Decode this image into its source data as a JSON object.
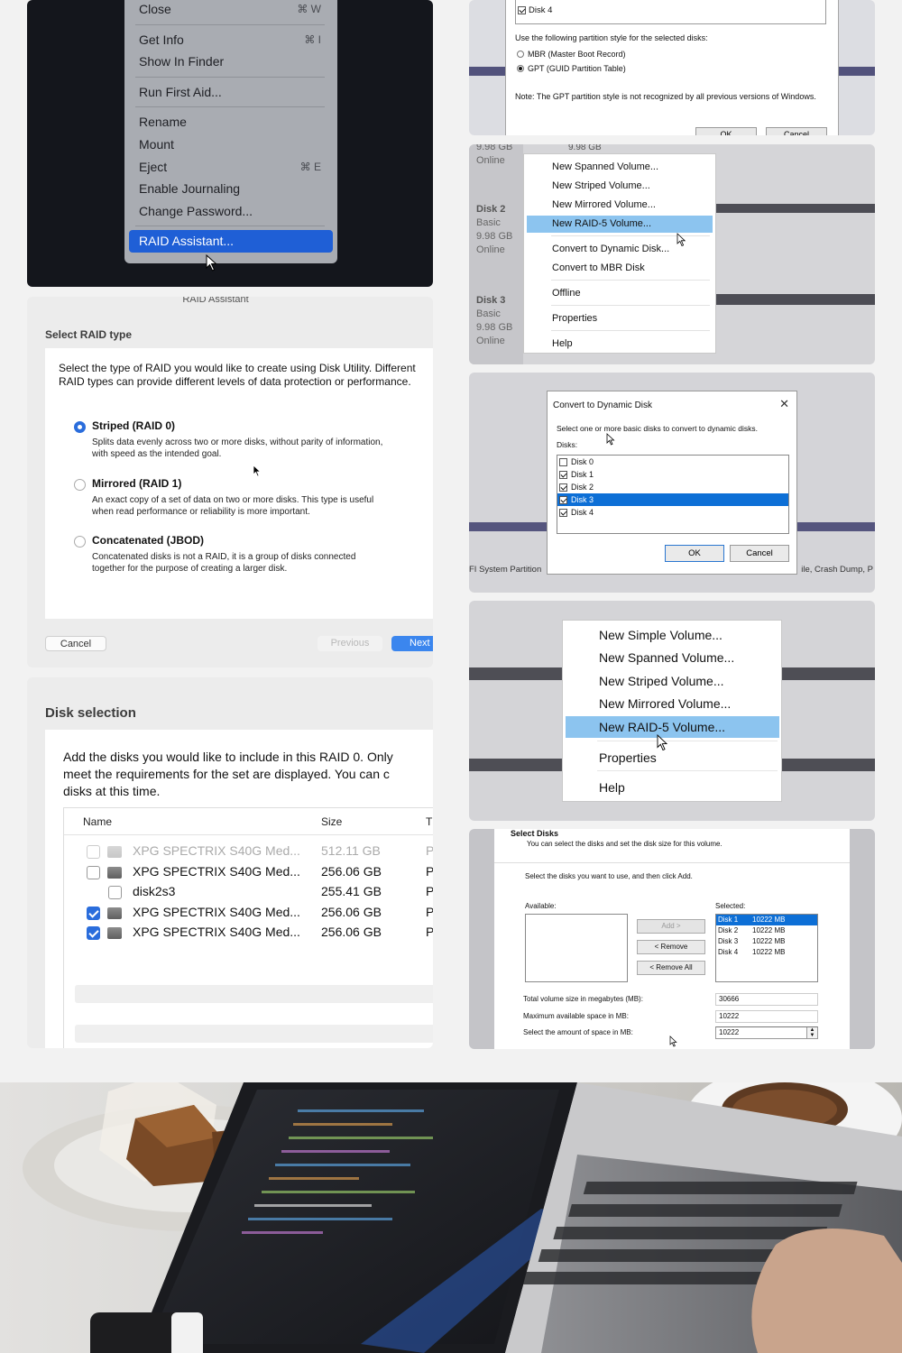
{
  "mac_context_menu": {
    "items": [
      {
        "label": "Close",
        "shortcut": "⌘ W"
      },
      {
        "sep": true
      },
      {
        "label": "Get Info",
        "shortcut": "⌘ I"
      },
      {
        "label": "Show In Finder",
        "shortcut": ""
      },
      {
        "sep": true
      },
      {
        "label": "Run First Aid...",
        "shortcut": ""
      },
      {
        "sep": true
      },
      {
        "label": "Rename",
        "shortcut": ""
      },
      {
        "label": "Mount",
        "shortcut": ""
      },
      {
        "label": "Eject",
        "shortcut": "⌘ E"
      },
      {
        "label": "Enable Journaling",
        "shortcut": ""
      },
      {
        "label": "Change Password...",
        "shortcut": ""
      },
      {
        "sep": true
      },
      {
        "label": "RAID Assistant...",
        "shortcut": "",
        "selected": true
      }
    ]
  },
  "partition_dialog": {
    "list_item": "Disk 4",
    "prompt": "Use the following partition style for the selected disks:",
    "option_mbr": "MBR (Master Boot Record)",
    "option_gpt": "GPT (GUID Partition Table)",
    "selected": "gpt",
    "note": "Note: The GPT partition style is not recognized by all previous versions of Windows.",
    "ok": "OK",
    "cancel": "Cancel"
  },
  "raid_type": {
    "window_title": "RAID Assistant",
    "section": "Select RAID type",
    "intro": "Select the type of RAID you would like to create using Disk Utility. Different RAID types can provide different levels of data protection or performance.",
    "options": [
      {
        "title": "Striped (RAID 0)",
        "desc": "Splits data evenly across two or more disks, without parity of information, with speed as the intended goal.",
        "selected": true
      },
      {
        "title": "Mirrored (RAID 1)",
        "desc": "An exact copy of a set of data on two or more disks. This type is useful when read performance or reliability is more important.",
        "selected": false
      },
      {
        "title": "Concatenated (JBOD)",
        "desc": "Concatenated disks is not a RAID, it is a group of disks connected together for the purpose of creating a larger disk.",
        "selected": false
      }
    ],
    "cancel": "Cancel",
    "previous": "Previous",
    "next": "Next"
  },
  "win_volume_menu": {
    "header": "9.98 GB",
    "disks": [
      {
        "line1": "9.98 GB",
        "line2": "Online"
      },
      {
        "line1": "Disk 2",
        "line2": "Basic",
        "line3": "9.98 GB",
        "line4": "Online"
      },
      {
        "line1": "Disk 3",
        "line2": "Basic",
        "line3": "9.98 GB",
        "line4": "Online"
      }
    ],
    "items": [
      {
        "label": "New Spanned Volume..."
      },
      {
        "label": "New Striped Volume..."
      },
      {
        "label": "New Mirrored Volume..."
      },
      {
        "label": "New RAID-5 Volume...",
        "selected": true
      },
      {
        "label": "Convert to Dynamic Disk..."
      },
      {
        "label": "Convert to MBR Disk"
      },
      {
        "label": "Offline"
      },
      {
        "label": "Properties"
      },
      {
        "label": "Help"
      }
    ]
  },
  "convert_dialog": {
    "title": "Convert to Dynamic Disk",
    "message": "Select one or more basic disks to convert to dynamic disks.",
    "disks_label": "Disks:",
    "disks": [
      {
        "name": "Disk 0",
        "checked": false,
        "selected": false
      },
      {
        "name": "Disk 1",
        "checked": true,
        "selected": false
      },
      {
        "name": "Disk 2",
        "checked": true,
        "selected": false
      },
      {
        "name": "Disk 3",
        "checked": true,
        "selected": true
      },
      {
        "name": "Disk 4",
        "checked": true,
        "selected": false
      }
    ],
    "ok": "OK",
    "cancel": "Cancel",
    "bg_left": "FI System Partition",
    "bg_right": "ile, Crash Dump, P"
  },
  "disk_selection": {
    "section": "Disk selection",
    "intro_lines": [
      "Add the disks you would like to include in this RAID 0. Only",
      "meet the requirements for the set are displayed. You can c",
      "disks at this time."
    ],
    "columns": {
      "name": "Name",
      "size": "Size",
      "type": "T"
    },
    "rows": [
      {
        "name": "XPG SPECTRIX S40G Med...",
        "size": "512.11 GB",
        "type": "P",
        "checked": false,
        "dim": true,
        "icon": true
      },
      {
        "name": "XPG SPECTRIX S40G Med...",
        "size": "256.06 GB",
        "type": "P",
        "checked": false,
        "dim": false,
        "icon": true
      },
      {
        "name": "disk2s3",
        "size": "255.41 GB",
        "type": "P",
        "checked": false,
        "dim": false,
        "icon": false
      },
      {
        "name": "XPG SPECTRIX S40G Med...",
        "size": "256.06 GB",
        "type": "P",
        "checked": true,
        "dim": false,
        "icon": true
      },
      {
        "name": "XPG SPECTRIX S40G Med...",
        "size": "256.06 GB",
        "type": "P",
        "checked": true,
        "dim": false,
        "icon": true
      }
    ]
  },
  "raid5_menu": {
    "items": [
      {
        "label": "New Simple Volume..."
      },
      {
        "label": "New Spanned Volume..."
      },
      {
        "label": "New Striped Volume..."
      },
      {
        "label": "New Mirrored Volume..."
      },
      {
        "label": "New RAID-5 Volume...",
        "selected": true
      },
      {
        "label": "Properties"
      },
      {
        "label": "Help"
      }
    ]
  },
  "select_disks": {
    "title": "Select Disks",
    "subtitle": "You can select the disks and set the disk size for this volume.",
    "instruction": "Select the disks you want to use, and then click Add.",
    "available_label": "Available:",
    "selected_label": "Selected:",
    "selected": [
      {
        "disk": "Disk 1",
        "size": "10222 MB",
        "highlight": true
      },
      {
        "disk": "Disk 2",
        "size": "10222 MB",
        "highlight": false
      },
      {
        "disk": "Disk 3",
        "size": "10222 MB",
        "highlight": false
      },
      {
        "disk": "Disk 4",
        "size": "10222 MB",
        "highlight": false
      }
    ],
    "add": "Add >",
    "remove": "< Remove",
    "remove_all": "< Remove All",
    "total_label": "Total volume size in megabytes (MB):",
    "total_value": "30666",
    "max_label": "Maximum available space in MB:",
    "max_value": "10222",
    "amount_label": "Select the amount of space in MB:",
    "amount_value": "10222"
  },
  "colors": {
    "mac_accent": "#2a6ddc",
    "mac_menu_selected": "#1f5fd6",
    "win_highlight": "#8cc4ef",
    "win_selected_row": "#0d6fd6",
    "disk_band": "#52527c"
  }
}
